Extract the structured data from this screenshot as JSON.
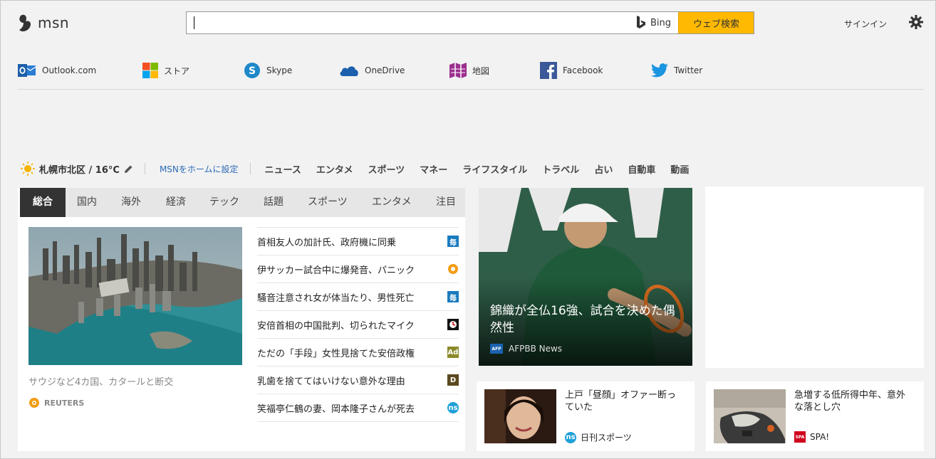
{
  "header": {
    "logo_text": "msn",
    "search_placeholder": "",
    "bing_label": "Bing",
    "search_button": "ウェブ検索",
    "signin": "サインイン"
  },
  "quick_links": [
    {
      "label": "Outlook.com",
      "icon": "outlook-icon"
    },
    {
      "label": "ストア",
      "icon": "store-icon"
    },
    {
      "label": "Skype",
      "icon": "skype-icon"
    },
    {
      "label": "OneDrive",
      "icon": "onedrive-icon"
    },
    {
      "label": "地図",
      "icon": "map-icon"
    },
    {
      "label": "Facebook",
      "icon": "facebook-icon"
    },
    {
      "label": "Twitter",
      "icon": "twitter-icon"
    }
  ],
  "subnav": {
    "weather": "札幌市北区 / 16°C",
    "set_home": "MSNをホームに設定",
    "categories": [
      "ニュース",
      "エンタメ",
      "スポーツ",
      "マネー",
      "ライフスタイル",
      "トラベル",
      "占い",
      "自動車",
      "動画"
    ]
  },
  "news_panel": {
    "tabs": [
      "総合",
      "国内",
      "海外",
      "経済",
      "テック",
      "話題",
      "スポーツ",
      "エンタメ",
      "注目"
    ],
    "hero": {
      "caption": "サウジなど4カ国、カタールと断交",
      "source": "REUTERS"
    },
    "headlines": [
      {
        "title": "首相友人の加計氏、政府機に同乗",
        "badge": "毎"
      },
      {
        "title": "伊サッカー試合中に爆発音、パニック",
        "badge": "reuters"
      },
      {
        "title": "騒音注意され女が体当たり、男性死亡",
        "badge": "毎"
      },
      {
        "title": "安倍首相の中国批判、切られたマイク",
        "badge": "clock"
      },
      {
        "title": "ただの「手段」女性見捨てた安倍政権",
        "badge": "Ad"
      },
      {
        "title": "乳歯を捨ててはいけない意外な理由",
        "badge": "D"
      },
      {
        "title": "笑福亭仁鶴の妻、岡本隆子さんが死去",
        "badge": "ns"
      }
    ]
  },
  "feature": {
    "title": "錦織が全仏16強、試合を決めた偶然性",
    "source": "AFPBB News",
    "source_logo": "AFP"
  },
  "cards": [
    {
      "title": "上戸「昼顔」オファー断っていた",
      "source": "日刊スポーツ",
      "badge": "ns"
    },
    {
      "title": "急増する低所得中年、意外な落とし穴",
      "source": "SPA!",
      "badge": "SPA"
    }
  ],
  "colors": {
    "accent": "#ffb900",
    "link": "#2b6bb5",
    "tab_active": "#333333",
    "tab_bar": "#e6e6e6"
  }
}
